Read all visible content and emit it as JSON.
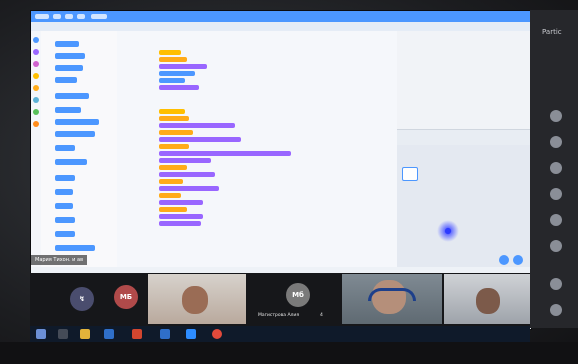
{
  "stage_url_strip": {},
  "participants_panel": {
    "title": "Partic",
    "avatars": 8
  },
  "presenter_label": "Мария Тихон. и ав",
  "video_tiles": [
    {
      "initials": "МБ",
      "color": "#b04a4a"
    },
    {
      "initials": "Мб",
      "color": "#8a8a8a",
      "name": "Магистрова Алия",
      "mic": "4"
    },
    {
      "initials": "",
      "name": "",
      "mic": ""
    }
  ],
  "avatar_left_icon": "video-off-icon",
  "taskbar_icons": [
    "windows-start-icon",
    "search-icon",
    "file-explorer-icon",
    "mail-icon",
    "powerpoint-icon",
    "word-icon",
    "zoom-icon",
    "chrome-icon"
  ],
  "colors": {
    "scratch_blue": "#4c97ff",
    "events_yellow": "#ffbf00",
    "looks_purple": "#9966ff",
    "pen_green": "#0fbd8c",
    "control_orange": "#ffab19"
  }
}
